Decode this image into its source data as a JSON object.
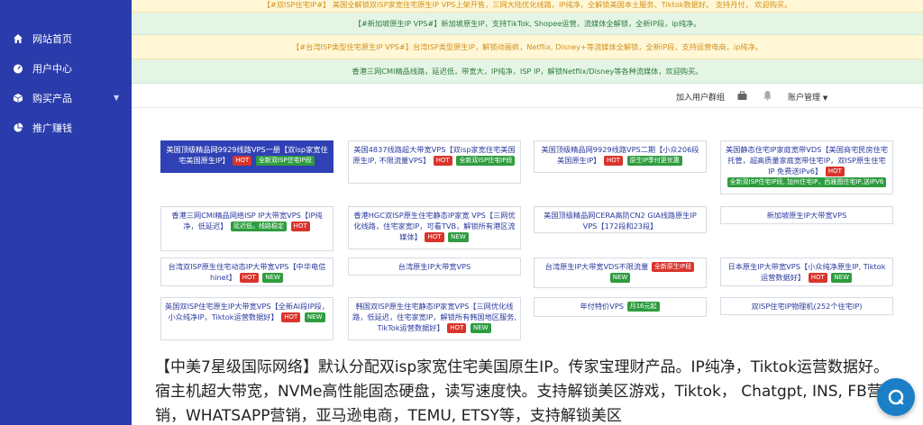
{
  "sidebar": {
    "items": [
      {
        "label": "网站首页",
        "icon": "home-icon"
      },
      {
        "label": "用户中心",
        "icon": "dashboard-icon"
      },
      {
        "label": "购买产品",
        "icon": "box-icon",
        "has_caret": true
      },
      {
        "label": "推广赚钱",
        "icon": "pie-chart-icon"
      }
    ]
  },
  "banners": [
    "【#双ISP住宅IP#】 美国全解锁双ISP家宽住宅原生IP VPS上架开售，三网大陆优化线路，IP纯净，全解锁美国本土服务、Tiktok数据好。 支持月付， 欢迎购买。",
    "【#新加坡原生IP VPS#】新加坡原生IP，支持TikTok, Shopee运营，流媒体全解锁，全新IP段，ip纯净。",
    "【#台湾ISP类型住宅原生IP VPS#】台湾ISP类型原生IP，解锁动画疯，Netflix, Disney+等流媒体全解锁，全新IP段，支持运营电商，ip纯净。",
    "香港三网CMI精品线路，延迟低，带宽大，IP纯净，ISP IP，解锁Netflix/Disney等各种流媒体，欢迎购买。"
  ],
  "topbar": {
    "group_link": "加入用户群组",
    "account_menu": "账户管理"
  },
  "cards": [
    {
      "title": "美国顶级精品网9929线路VPS一册【双isp家宽住宅美国原生IP】",
      "tags": [
        {
          "t": "HOT",
          "k": "hot"
        },
        {
          "t": "全新双ISP住宅IP段",
          "k": "green"
        }
      ]
    },
    {
      "title": "美国4837线路超大带宽VPS【双isp家宽住宅美国原生IP, 不限流量VPS】",
      "tags": [
        {
          "t": "HOT",
          "k": "hot"
        },
        {
          "t": "全新双ISP住宅IP段",
          "k": "green"
        }
      ]
    },
    {
      "title": "美国顶级精品网9929线路VPS二期【小众206段美国原生IP】",
      "tags": [
        {
          "t": "HOT",
          "k": "hot"
        },
        {
          "t": "原生IP季付更优惠",
          "k": "green"
        }
      ]
    },
    {
      "title": "美国静态住宅IP家庭宽带VDS【美国商宅民房住宅托管，超高质量家庭宽带住宅IP，双ISP原生住宅IP 免费送IPv6】",
      "tags": [
        {
          "t": "HOT",
          "k": "hot"
        },
        {
          "t": "全新双ISP住宅IP段, 加州住宅IP，西雅图住宅IP,送IPV6",
          "k": "green"
        }
      ]
    },
    {
      "title": "香港三网CMI精品网络ISP IP大带宽VPS【IP纯净，低延迟】",
      "tags": [
        {
          "t": "延迟低，线路稳定",
          "k": "green"
        },
        {
          "t": "HOT",
          "k": "hot"
        }
      ]
    },
    {
      "title": "香港HGC双ISP原生住宅静态IP家宽 VPS【三网优化线路，住宅家宽IP，可看TVB，解锁所有港区流媒体】",
      "tags": [
        {
          "t": "HOT",
          "k": "hot"
        },
        {
          "t": "NEW",
          "k": "new"
        }
      ]
    },
    {
      "title": "美国顶级精品网CERA高防CN2 GIA线路原生IP VPS【172段和23段】",
      "tags": []
    },
    {
      "title": "新加坡原生IP大带宽VPS",
      "tags": []
    },
    {
      "title": "台湾双ISP原生住宅动态IP大带宽VPS【中华电信hinet】",
      "tags": [
        {
          "t": "HOT",
          "k": "hot"
        },
        {
          "t": "NEW",
          "k": "new"
        }
      ]
    },
    {
      "title": "台湾原生IP大带宽VPS",
      "tags": []
    },
    {
      "title": "台湾原生IP大带宽VDS不限流量",
      "tags": [
        {
          "t": "全新原生IP段",
          "k": "red"
        },
        {
          "t": "NEW",
          "k": "new"
        }
      ]
    },
    {
      "title": "日本原生IP大带宽VPS【小众纯净原生IP, Tiktok运营数据好】",
      "tags": [
        {
          "t": "HOT",
          "k": "hot"
        },
        {
          "t": "NEW",
          "k": "new"
        }
      ]
    },
    {
      "title": "英国双ISP住宅原生IP大带宽VPS【全新AI段IP段，小众纯净IP，Tiktok运营数据好】",
      "tags": [
        {
          "t": "HOT",
          "k": "hot"
        },
        {
          "t": "NEW",
          "k": "new"
        }
      ]
    },
    {
      "title": "韩国双ISP原生住宅静态IP家宽VPS【三网优化线路，低延迟，住宅家宽IP，解锁所有韩国地区服务, TikTok运营数据好】",
      "tags": [
        {
          "t": "HOT",
          "k": "hot"
        },
        {
          "t": "NEW",
          "k": "new"
        }
      ]
    },
    {
      "title": "年付特价VPS",
      "tags": [
        {
          "t": "月16元起",
          "k": "green"
        }
      ]
    },
    {
      "title": "双ISP住宅IP物理机(252个住宅IP)",
      "tags": []
    }
  ],
  "description": "【中美7星级国际网络】默认分配双isp家宽住宅美国原生IP。传家宝理财产品。IP纯净，Tiktok运营数据好。 宿主机超大带宽，NVMe高性能固态硬盘，读写速度快。支持解锁美区游戏，Tiktok， Chatgpt, INS, FB营销，WHATSAPP营销，亚马逊电商，TEMU, ETSY等，支持解锁美区",
  "colors": {
    "sidebar": "#2a3cab",
    "accent": "#2f41b4",
    "hot": "#d9342b",
    "new": "#2e9c3f"
  }
}
